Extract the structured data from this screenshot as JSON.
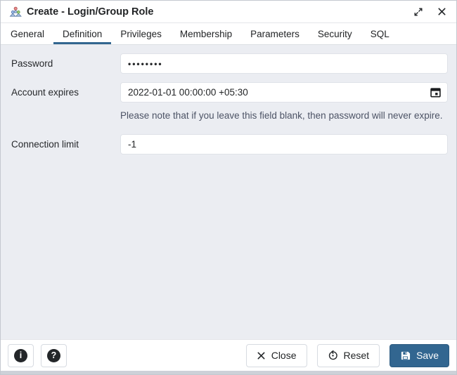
{
  "window": {
    "title": "Create - Login/Group Role"
  },
  "tabs": [
    {
      "label": "General",
      "active": false
    },
    {
      "label": "Definition",
      "active": true
    },
    {
      "label": "Privileges",
      "active": false
    },
    {
      "label": "Membership",
      "active": false
    },
    {
      "label": "Parameters",
      "active": false
    },
    {
      "label": "Security",
      "active": false
    },
    {
      "label": "SQL",
      "active": false
    }
  ],
  "form": {
    "password": {
      "label": "Password",
      "value": "••••••••"
    },
    "account_expires": {
      "label": "Account expires",
      "value": "2022-01-01 00:00:00 +05:30",
      "note": "Please note that if you leave this field blank, then password will never expire."
    },
    "connection_limit": {
      "label": "Connection limit",
      "value": "-1"
    }
  },
  "footer": {
    "info_glyph": "i",
    "help_glyph": "?",
    "close_label": "Close",
    "reset_label": "Reset",
    "save_label": "Save"
  },
  "colors": {
    "accent": "#326690",
    "content_background": "#ebedf2"
  }
}
